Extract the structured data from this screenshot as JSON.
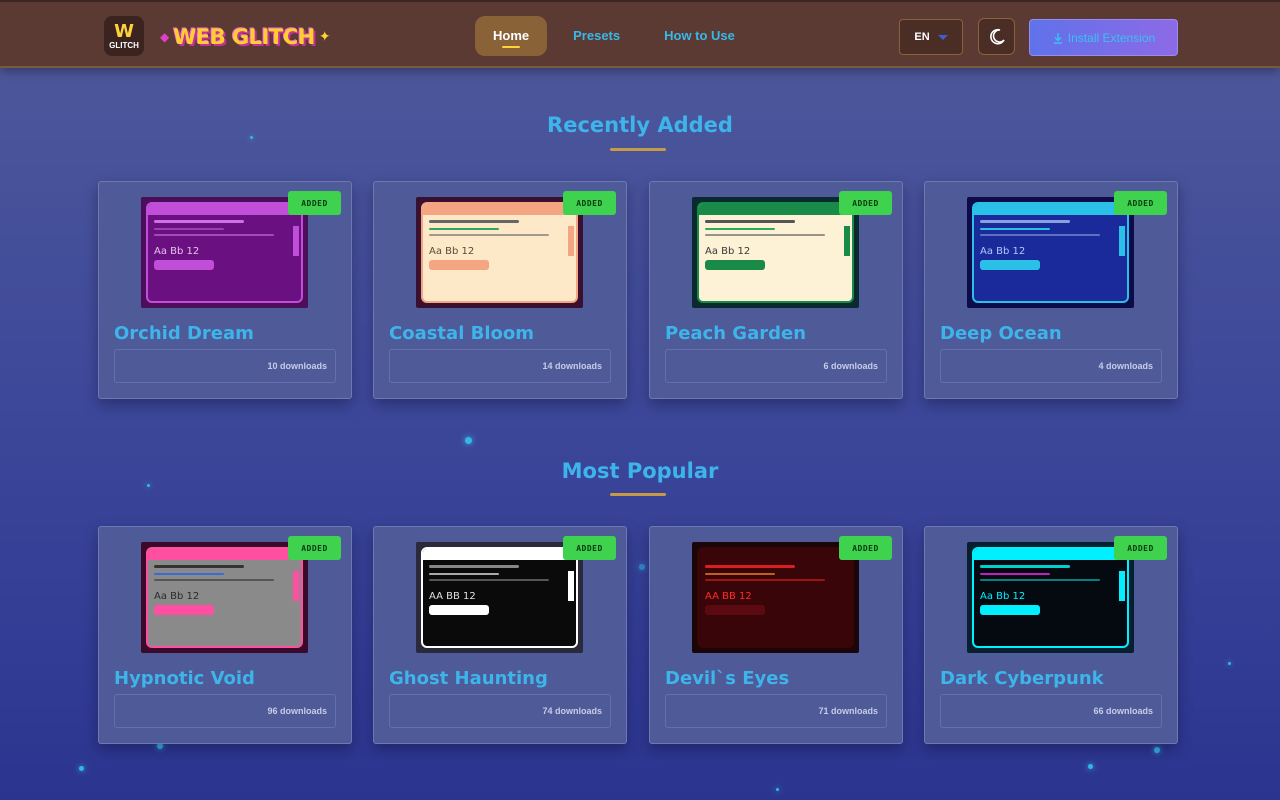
{
  "header": {
    "logo_mark": "W",
    "logo_sub": "GLITCH",
    "brand": "WEB GLITCH",
    "nav": [
      {
        "label": "Home",
        "active": true
      },
      {
        "label": "Presets",
        "active": false
      },
      {
        "label": "How to Use",
        "active": false
      }
    ],
    "language": "EN",
    "theme_icon": "moon-icon",
    "install_label": "Install Extension",
    "install_icon": "download-icon"
  },
  "sections": [
    {
      "title": "Recently Added",
      "cards": [
        {
          "name": "Orchid Dream",
          "downloads": "10 downloads",
          "badge": "ADDED",
          "sample": "Aa Bb 12",
          "colors": {
            "frame": "#4a0e5a",
            "bg": "#6a1080",
            "bar": "#c04ed8",
            "text": "#e8c0f0",
            "btn": "#c04ed8",
            "line": "#d070e8",
            "line2": "#9a40b0"
          }
        },
        {
          "name": "Coastal Bloom",
          "downloads": "14 downloads",
          "badge": "ADDED",
          "sample": "Aa Bb 12",
          "colors": {
            "frame": "#3a1030",
            "bg": "#fde9c8",
            "bar": "#f4a582",
            "text": "#5a4a3a",
            "btn": "#f4a582",
            "line": "#666666",
            "line2": "#2ea860"
          }
        },
        {
          "name": "Peach Garden",
          "downloads": "6 downloads",
          "badge": "ADDED",
          "sample": "Aa Bb 12",
          "colors": {
            "frame": "#0b2a30",
            "bg": "#fdf1d6",
            "bar": "#1a8a48",
            "text": "#3a3a3a",
            "btn": "#1a8a48",
            "line": "#555555",
            "line2": "#2ea860"
          }
        },
        {
          "name": "Deep Ocean",
          "downloads": "4 downloads",
          "badge": "ADDED",
          "sample": "Aa Bb 12",
          "colors": {
            "frame": "#0c0c4a",
            "bg": "#1a2a9a",
            "bar": "#2ac0e8",
            "text": "#b0c8ff",
            "btn": "#2ac0e8",
            "line": "#8aa0e0",
            "line2": "#2ac0e8"
          }
        }
      ]
    },
    {
      "title": "Most Popular",
      "cards": [
        {
          "name": "Hypnotic Void",
          "downloads": "96 downloads",
          "badge": "ADDED",
          "sample": "Aa Bb 12",
          "colors": {
            "frame": "#3a0a2a",
            "bg": "#8a8a8a",
            "bar": "#ff4fa0",
            "text": "#2a2a2a",
            "btn": "#ff4fa0",
            "line": "#333333",
            "line2": "#3a6ad8"
          }
        },
        {
          "name": "Ghost Haunting",
          "downloads": "74 downloads",
          "badge": "ADDED",
          "sample": "AA BB 12",
          "colors": {
            "frame": "#2a2a3a",
            "bg": "#0a0a0a",
            "bar": "#ffffff",
            "text": "#e0e0e0",
            "btn": "#ffffff",
            "line": "#888888",
            "line2": "#aaaaaa"
          }
        },
        {
          "name": "Devil`s Eyes",
          "downloads": "71 downloads",
          "badge": "ADDED",
          "sample": "AA BB 12",
          "colors": {
            "frame": "#1a0508",
            "bg": "#3a0508",
            "bar": "#3a0508",
            "text": "#ff2a2a",
            "btn": "#5a0a10",
            "line": "#d82020",
            "line2": "#c06020"
          }
        },
        {
          "name": "Dark Cyberpunk",
          "downloads": "66 downloads",
          "badge": "ADDED",
          "sample": "Aa Bb 12",
          "colors": {
            "frame": "#062030",
            "bg": "#050a10",
            "bar": "#00f0ff",
            "text": "#00f0ff",
            "btn": "#00f0ff",
            "line": "#00d0d0",
            "line2": "#c020c0"
          }
        }
      ]
    }
  ]
}
